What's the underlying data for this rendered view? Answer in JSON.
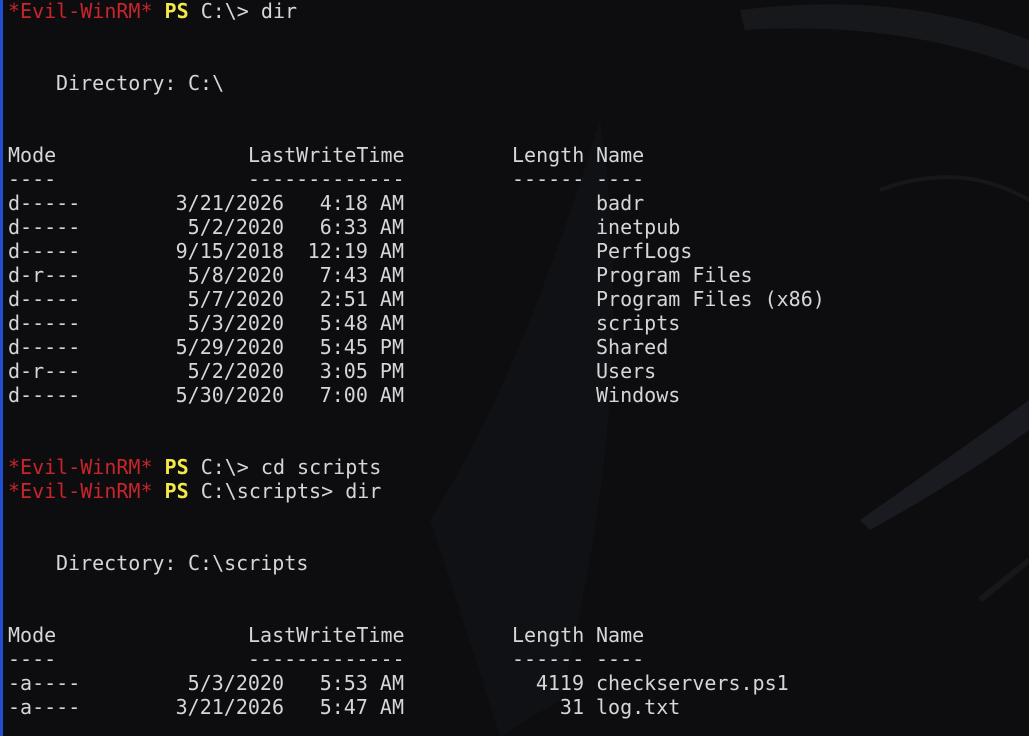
{
  "prompt": {
    "tag": "*Evil-WinRM*",
    "ps": "PS"
  },
  "colors": {
    "background": "#0d0d0f",
    "text": "#d6d6d6",
    "prompt_tag": "#c8242a",
    "prompt_ps": "#f2e84a",
    "left_edge": "#1f4fd0"
  },
  "commands": [
    {
      "path": "C:\\>",
      "cmd": "dir"
    },
    {
      "path": "C:\\>",
      "cmd": "cd scripts"
    },
    {
      "path": "C:\\scripts>",
      "cmd": "dir"
    }
  ],
  "listings": [
    {
      "directory_label": "Directory:",
      "directory_path": "C:\\",
      "headers": {
        "mode": "Mode",
        "lwt": "LastWriteTime",
        "length": "Length",
        "name": "Name"
      },
      "underlines": {
        "mode": "----",
        "lwt": "-------------",
        "length": "------",
        "name": "----"
      },
      "rows": [
        {
          "mode": "d-----",
          "date": "3/21/2026",
          "time": "4:18 AM",
          "length": "",
          "name": "badr"
        },
        {
          "mode": "d-----",
          "date": "5/2/2020",
          "time": "6:33 AM",
          "length": "",
          "name": "inetpub"
        },
        {
          "mode": "d-----",
          "date": "9/15/2018",
          "time": "12:19 AM",
          "length": "",
          "name": "PerfLogs"
        },
        {
          "mode": "d-r---",
          "date": "5/8/2020",
          "time": "7:43 AM",
          "length": "",
          "name": "Program Files"
        },
        {
          "mode": "d-----",
          "date": "5/7/2020",
          "time": "2:51 AM",
          "length": "",
          "name": "Program Files (x86)"
        },
        {
          "mode": "d-----",
          "date": "5/3/2020",
          "time": "5:48 AM",
          "length": "",
          "name": "scripts"
        },
        {
          "mode": "d-----",
          "date": "5/29/2020",
          "time": "5:45 PM",
          "length": "",
          "name": "Shared"
        },
        {
          "mode": "d-r---",
          "date": "5/2/2020",
          "time": "3:05 PM",
          "length": "",
          "name": "Users"
        },
        {
          "mode": "d-----",
          "date": "5/30/2020",
          "time": "7:00 AM",
          "length": "",
          "name": "Windows"
        }
      ]
    },
    {
      "directory_label": "Directory:",
      "directory_path": "C:\\scripts",
      "headers": {
        "mode": "Mode",
        "lwt": "LastWriteTime",
        "length": "Length",
        "name": "Name"
      },
      "underlines": {
        "mode": "----",
        "lwt": "-------------",
        "length": "------",
        "name": "----"
      },
      "rows": [
        {
          "mode": "-a----",
          "date": "5/3/2020",
          "time": "5:53 AM",
          "length": "4119",
          "name": "checkservers.ps1"
        },
        {
          "mode": "-a----",
          "date": "3/21/2026",
          "time": "5:47 AM",
          "length": "31",
          "name": "log.txt"
        }
      ]
    }
  ]
}
